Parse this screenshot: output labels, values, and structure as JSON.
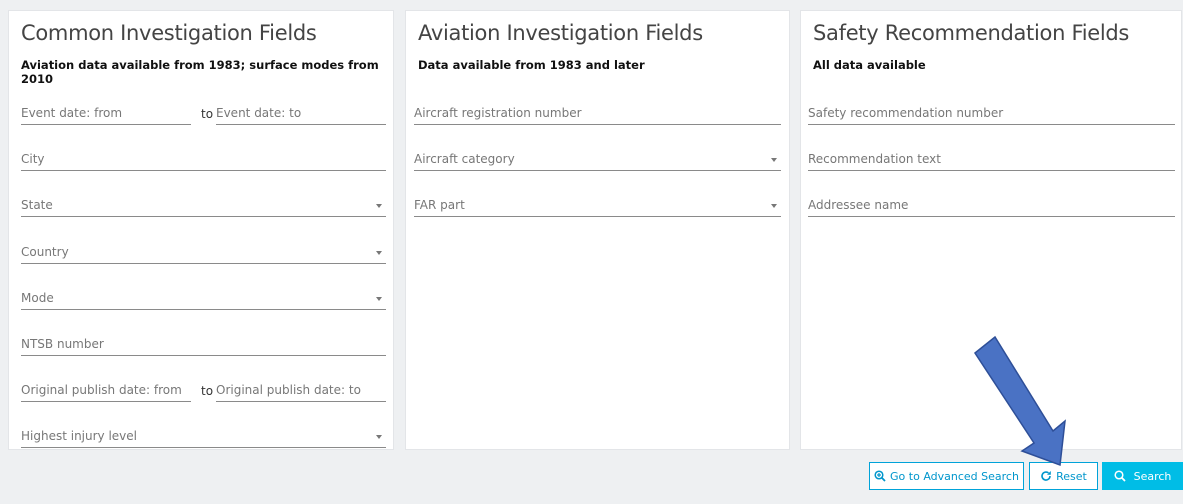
{
  "common": {
    "title": "Common Investigation Fields",
    "subtitle": "Aviation data available from 1983; surface modes from 2010",
    "event_date_from": "Event date: from",
    "to_label": "to",
    "event_date_to": "Event date: to",
    "city": "City",
    "state": "State",
    "country": "Country",
    "mode": "Mode",
    "ntsb_number": "NTSB number",
    "pub_date_from": "Original publish date: from",
    "pub_date_to": "Original publish date: to",
    "injury_level": "Highest injury level"
  },
  "aviation": {
    "title": "Aviation Investigation Fields",
    "subtitle": "Data available from 1983 and later",
    "registration": "Aircraft registration number",
    "category": "Aircraft category",
    "far_part": "FAR part"
  },
  "safety": {
    "title": "Safety Recommendation Fields",
    "subtitle": "All data available",
    "rec_number": "Safety recommendation number",
    "rec_text": "Recommendation text",
    "addressee": "Addressee name"
  },
  "actions": {
    "advanced": "Go to Advanced Search",
    "reset": "Reset",
    "search": "Search"
  },
  "colors": {
    "accent": "#00bde6",
    "arrow": "#4a72c4"
  }
}
